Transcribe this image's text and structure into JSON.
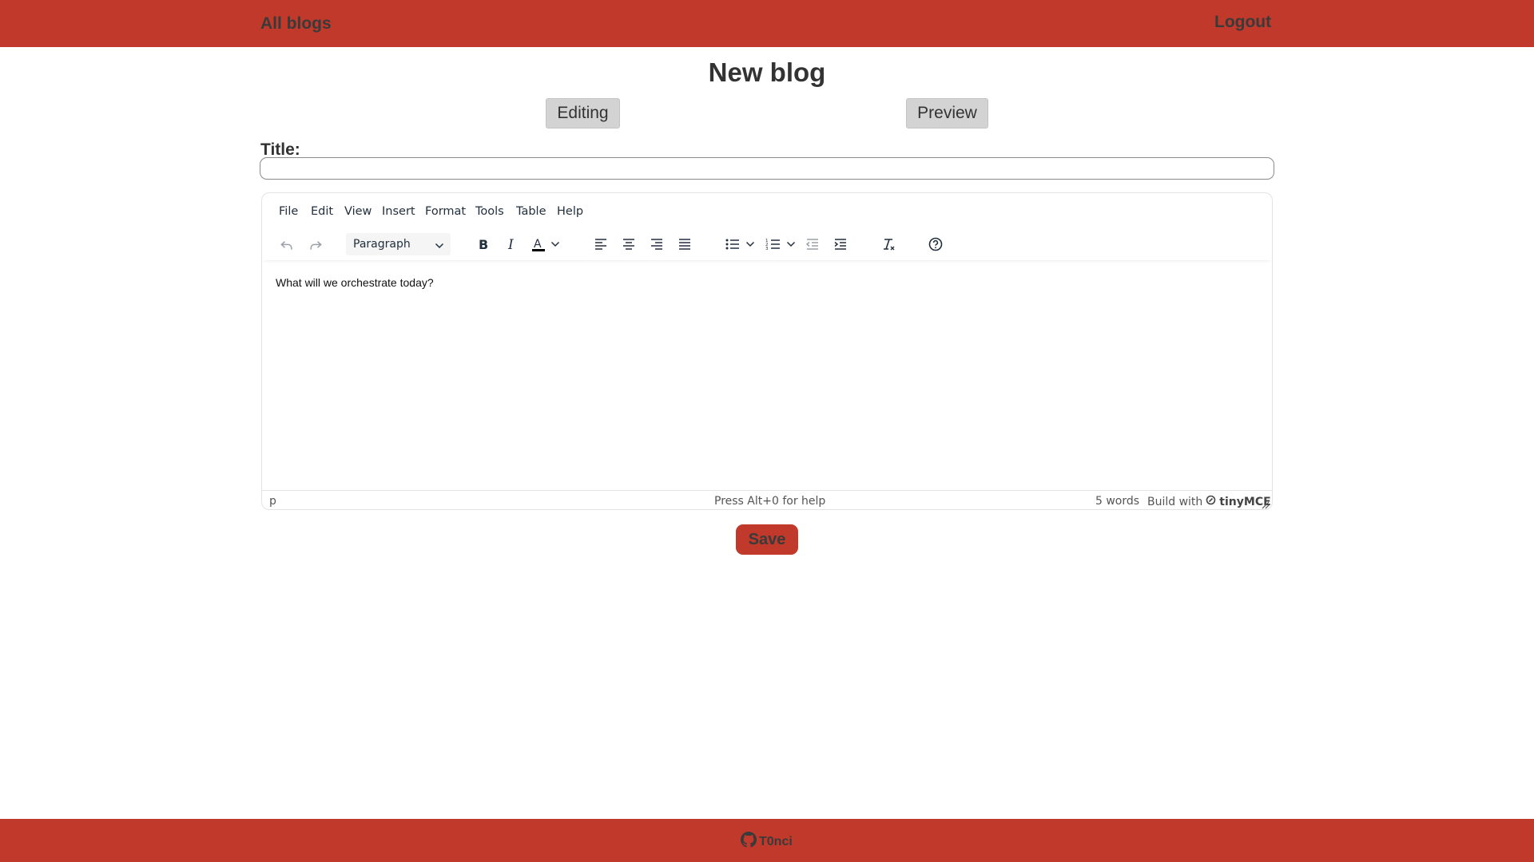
{
  "nav": {
    "all_blogs": "All blogs",
    "logout": "Logout"
  },
  "page": {
    "title": "New blog"
  },
  "modes": {
    "editing": "Editing",
    "preview": "Preview"
  },
  "form": {
    "title_label": "Title:",
    "title_value": ""
  },
  "editor": {
    "menu": [
      "File",
      "Edit",
      "View",
      "Insert",
      "Format",
      "Tools",
      "Table",
      "Help"
    ],
    "block_format": "Paragraph",
    "content_text": "What will we orchestrate today?",
    "status": {
      "path": "p",
      "help": "Press Alt+0 for help",
      "word_count": "5 words",
      "brand_prefix": "Build with",
      "brand_name": "tinyMCE"
    }
  },
  "actions": {
    "save": "Save"
  },
  "footer": {
    "github_user": "T0nci"
  },
  "colors": {
    "accent": "#c0392b",
    "button_gray": "#d3d3d3"
  }
}
